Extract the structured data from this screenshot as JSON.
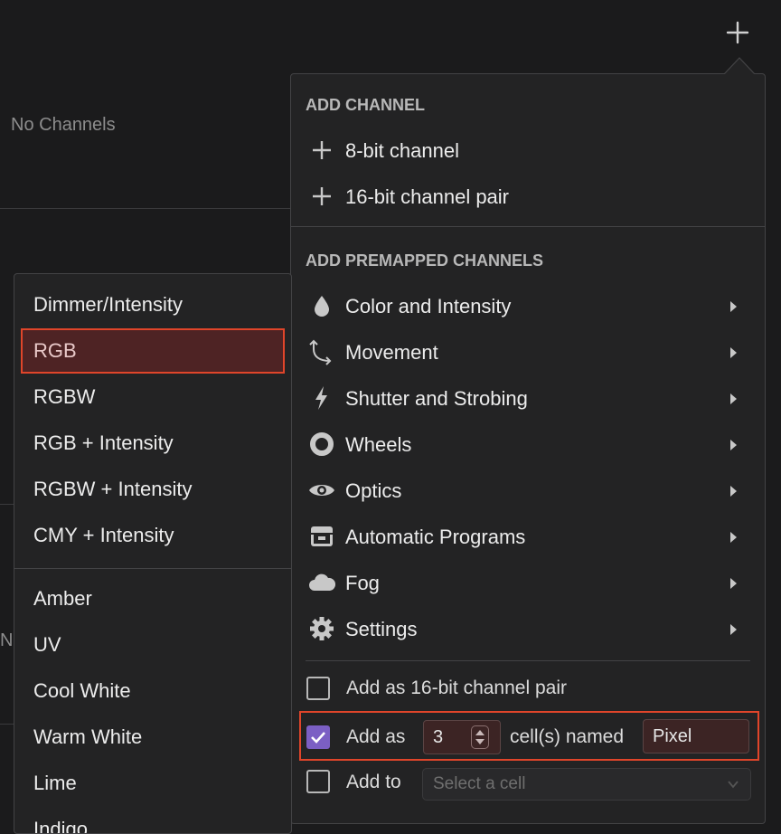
{
  "background": {
    "empty_text": "No Channels",
    "empty_text_partial": "No"
  },
  "add_button_icon": "plus-icon",
  "right_menu": {
    "add_channel_header": "ADD CHANNEL",
    "add_channel_items": [
      {
        "label": "8-bit channel",
        "icon": "plus-icon"
      },
      {
        "label": "16-bit channel pair",
        "icon": "plus-icon"
      }
    ],
    "premapped_header": "ADD PREMAPPED CHANNELS",
    "premapped_items": [
      {
        "label": "Color and Intensity",
        "icon": "droplet-icon"
      },
      {
        "label": "Movement",
        "icon": "movement-arrows-icon"
      },
      {
        "label": "Shutter and Strobing",
        "icon": "lightning-icon"
      },
      {
        "label": "Wheels",
        "icon": "ring-icon"
      },
      {
        "label": "Optics",
        "icon": "eye-icon"
      },
      {
        "label": "Automatic Programs",
        "icon": "box-icon"
      },
      {
        "label": "Fog",
        "icon": "cloud-icon"
      },
      {
        "label": "Settings",
        "icon": "gear-icon"
      }
    ],
    "options": {
      "add_16bit_label": "Add as 16-bit channel pair",
      "add_16bit_checked": false,
      "add_as_label": "Add as",
      "add_as_checked": true,
      "cell_count": "3",
      "cells_named_label": "cell(s) named",
      "cell_name": "Pixel",
      "add_to_label": "Add to",
      "add_to_checked": false,
      "select_cell_placeholder": "Select a cell"
    }
  },
  "left_menu": {
    "group1": [
      "Dimmer/Intensity",
      "RGB",
      "RGBW",
      "RGB + Intensity",
      "RGBW + Intensity",
      "CMY + Intensity"
    ],
    "group2": [
      "Amber",
      "UV",
      "Cool White",
      "Warm White",
      "Lime",
      "Indigo"
    ],
    "selected": "RGB"
  },
  "colors": {
    "accent_checkbox": "#7b5fc4",
    "highlight_border": "#e0452a",
    "selected_bg": "#4e2324"
  }
}
